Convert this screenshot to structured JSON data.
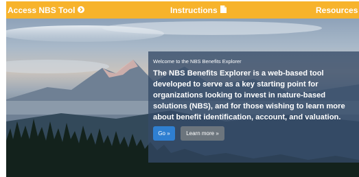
{
  "navbar": {
    "access_label": "Access NBS Tool",
    "instructions_label": "Instructions",
    "resources_label": "Resources",
    "access_icon": "arrow-circle-right-icon",
    "instructions_icon": "document-icon",
    "resources_icon": "book-icon",
    "background": "#f7b32b"
  },
  "hero": {
    "kicker": "Welcome to the NBS Benefits Explorer",
    "headline": "The NBS Benefits Explorer is a web-based tool developed to serve as a key starting point for organizations looking to invest in nature-based solutions (NBS), and for those wishing to learn more about benefit identification, account, and valuation.",
    "go_label": "Go »",
    "learn_more_label": "Learn more »",
    "panel_color": "#344a68",
    "go_color": "#2f7fd1",
    "learn_color": "#6c757d"
  }
}
